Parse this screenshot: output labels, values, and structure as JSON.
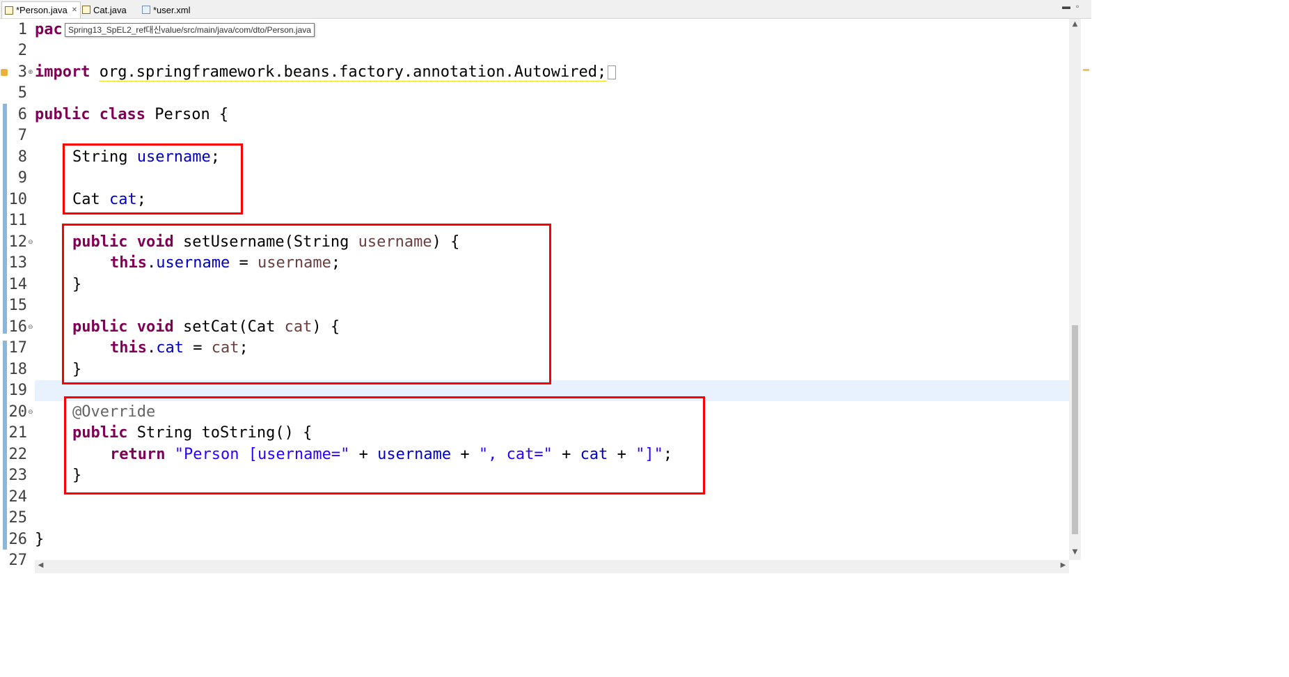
{
  "tabs": [
    {
      "label": "*Person.java",
      "icon": "java-file-icon",
      "close": "✕",
      "active": true
    },
    {
      "label": "Cat.java",
      "icon": "java-file-icon",
      "active": false
    },
    {
      "label": "*user.xml",
      "icon": "xml-file-icon",
      "active": false
    }
  ],
  "window_controls": {
    "minimize": "▬",
    "maximize": "▫"
  },
  "tooltip": "Spring13_SpEL2_ref대신value/src/main/java/com/dto/Person.java",
  "line_numbers": [
    "1",
    "2",
    "3",
    "5",
    "6",
    "7",
    "8",
    "9",
    "10",
    "11",
    "12",
    "13",
    "14",
    "15",
    "16",
    "17",
    "18",
    "19",
    "20",
    "21",
    "22",
    "23",
    "24",
    "25",
    "26",
    "27"
  ],
  "code": {
    "l1_kw": "pac",
    "l3_kw": "import",
    "l3_rest": "org.springframework.beans.factory.annotation.Autowired;",
    "l6_kw1": "public",
    "l6_kw2": "class",
    "l6_rest": "Person {",
    "l8_type": "String",
    "l8_field": "username",
    "l8_end": ";",
    "l10_type": "Cat",
    "l10_field": "cat",
    "l10_end": ";",
    "l12_kw1": "public",
    "l12_kw2": "void",
    "l12_mid": "setUsername(String",
    "l12_param": "username",
    "l12_end": ") {",
    "l13_kw": "this",
    "l13_dot": ".",
    "l13_field": "username",
    "l13_eq": " = ",
    "l13_param": "username",
    "l13_end": ";",
    "l14": "}",
    "l16_kw1": "public",
    "l16_kw2": "void",
    "l16_mid": "setCat(Cat",
    "l16_param": "cat",
    "l16_end": ") {",
    "l17_kw": "this",
    "l17_dot": ".",
    "l17_field": "cat",
    "l17_eq": " = ",
    "l17_param": "cat",
    "l17_end": ";",
    "l18": "}",
    "l20_ann": "@Override",
    "l21_kw": "public",
    "l21_rest": "String toString() {",
    "l22_kw": "return",
    "l22_s1": "\"Person [username=\"",
    "l22_p1": " + ",
    "l22_f1": "username",
    "l22_p2": " + ",
    "l22_s2": "\", cat=\"",
    "l22_p3": " + ",
    "l22_f2": "cat",
    "l22_p4": " + ",
    "l22_s3": "\"]\"",
    "l22_end": ";",
    "l23": "}",
    "l26": "}"
  },
  "colors": {
    "keyword": "#7f0055",
    "field": "#0000c0",
    "parameter": "#6a3e3e",
    "string": "#2a00ff",
    "annotation": "#646464",
    "highlight_box": "#ff0000",
    "current_line": "#e8f2fe"
  }
}
